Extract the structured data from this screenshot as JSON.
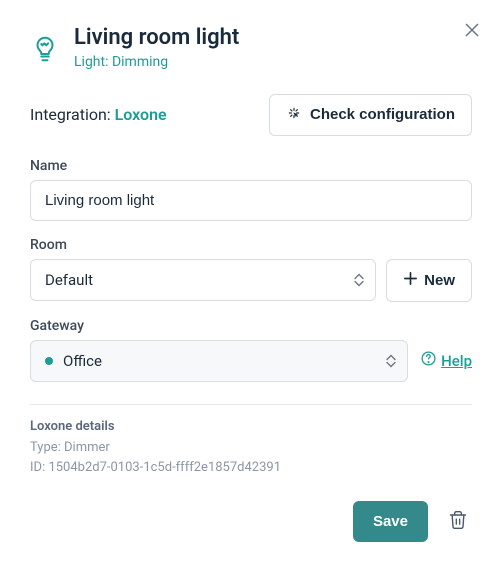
{
  "header": {
    "title": "Living room light",
    "subtitle": "Light: Dimming"
  },
  "integration": {
    "label": "Integration: ",
    "brand": "Loxone",
    "check_label": "Check configuration"
  },
  "fields": {
    "name": {
      "label": "Name",
      "value": "Living room light"
    },
    "room": {
      "label": "Room",
      "selected": "Default",
      "new_label": "New"
    },
    "gateway": {
      "label": "Gateway",
      "selected": "Office",
      "help_label": "Help"
    }
  },
  "details": {
    "title": "Loxone details",
    "type_line": "Type: Dimmer",
    "id_line": "ID: 1504b2d7-0103-1c5d-ffff2e1857d42391"
  },
  "footer": {
    "save_label": "Save"
  }
}
